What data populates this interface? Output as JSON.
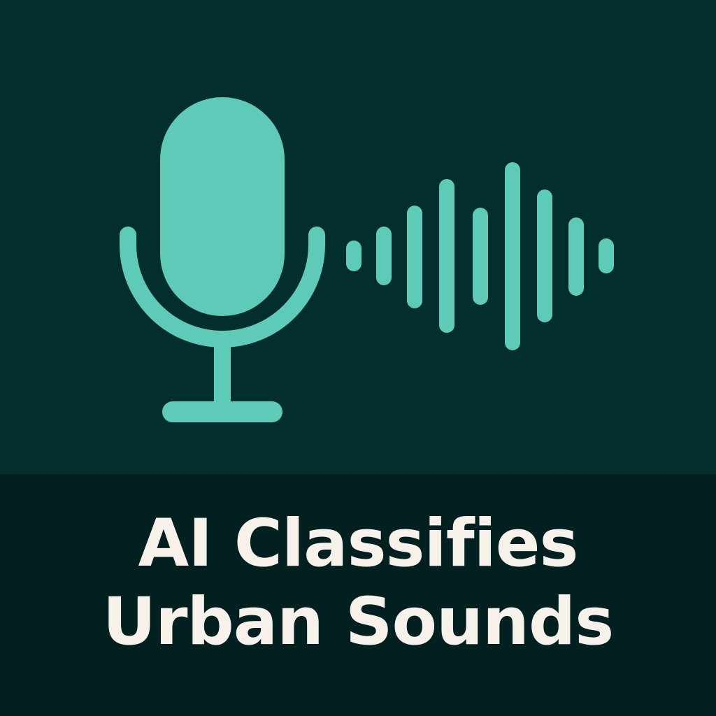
{
  "title": {
    "line1": "AI Classifies",
    "line2": "Urban Sounds"
  },
  "icons": {
    "microphone": "microphone-icon",
    "waveform": "sound-wave-icon"
  },
  "colors": {
    "background_top": "#022f2e",
    "background_bottom": "#02201f",
    "accent": "#5ecab8",
    "text": "#f7f2e9"
  }
}
